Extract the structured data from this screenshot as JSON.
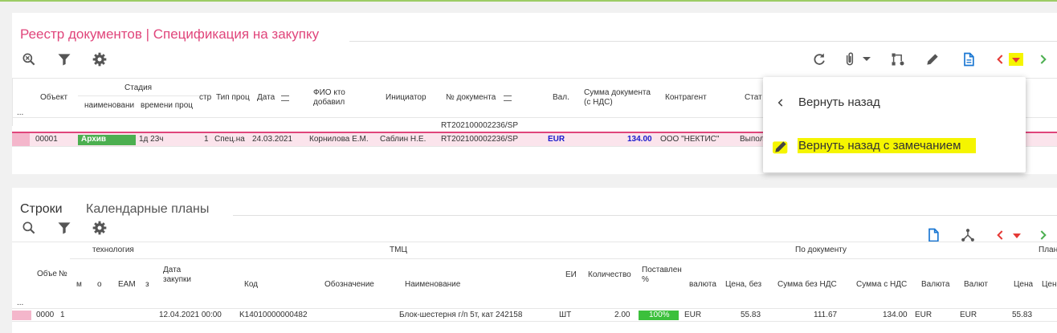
{
  "colors": {
    "accent": "#e0457b",
    "blue": "#1976d2",
    "green": "#4caf50",
    "red": "#e53935",
    "highlight": "#f5f500",
    "archive": "#4caf50"
  },
  "registry": {
    "title": "Реестр документов | Спецификация на закупку",
    "toolbar_icons": [
      "zoom-search-icon",
      "filter-icon",
      "gear-icon"
    ],
    "right_icons": [
      "refresh-icon",
      "paperclip-icon",
      "workflow-icon",
      "pencil-icon",
      "document-icon",
      "prev-icon",
      "dropdown-arrow-icon",
      "next-icon"
    ],
    "headers": {
      "obj": "Объект",
      "stage": "Стадия",
      "stage_name": "наименовани",
      "stage_time": "времени проц",
      "str": "стр",
      "type": "Тип проц",
      "date": "Дата",
      "fio": "ФИО кто добавил",
      "initiator": "Инициатор",
      "docnum": "№ документа",
      "cur": "Вал.",
      "sum": "Сумма документа (с НДС)",
      "contractor": "Контрагент",
      "status": "Стат",
      "dots": "..."
    },
    "group_row": "RT202100002236/SP",
    "row": {
      "obj": "00001",
      "stage": "Архив",
      "time": "1д 23ч",
      "str": "1",
      "type": "Спец.на",
      "date": "24.03.2021",
      "fio": "Корнилова Е.М.",
      "initiator": "Саблин Н.Е.",
      "docnum": "RT202100002236/SP",
      "cur": "EUR",
      "sum": "134.00",
      "contractor": "ООО \"НЕКТИС\"",
      "status": "Выпол"
    }
  },
  "menu": {
    "items": [
      {
        "icon": "chevron-left-icon",
        "label": "Вернуть назад"
      },
      {
        "icon": "pencil-icon",
        "label": "Вернуть назад с замечанием"
      }
    ]
  },
  "lines": {
    "tabs": [
      "Строки",
      "Календарные планы"
    ],
    "headers": {
      "tech": "технология",
      "tmc": "ТМЦ",
      "bydoc": "По документу",
      "plan": "План",
      "obj": "Объе",
      "no": "№",
      "m": "м",
      "o": "о",
      "eam": "EAM",
      "z": "з",
      "date": "Дата закупки",
      "code": "Код",
      "desig": "Обозначение",
      "name": "Наименование",
      "ei": "ЕИ",
      "qty": "Количество",
      "deliv": "Поставлен %",
      "val": "валюта",
      "price": "Цена, без",
      "sum_no": "Сумма без НДС",
      "sum_with": "Сумма с НДС",
      "val2": "Валюта",
      "val3": "Валют",
      "price2": "Цена",
      "price3": "Цен",
      "dots": "..."
    },
    "row": {
      "obj": "0000",
      "no": "1",
      "date": "12.04.2021 00:00",
      "code": "K14010000000482",
      "name": "Блок-шестерня г/п 5т, кат 242158",
      "ei": "ШТ",
      "qty": "2.00",
      "deliv": "100%",
      "deliv_value": 1.0,
      "val": "EUR",
      "price": "55.83",
      "sum_no": "111.67",
      "sum_with": "134.00",
      "val2": "EUR",
      "val3": "EUR",
      "price2": "55.83"
    }
  }
}
